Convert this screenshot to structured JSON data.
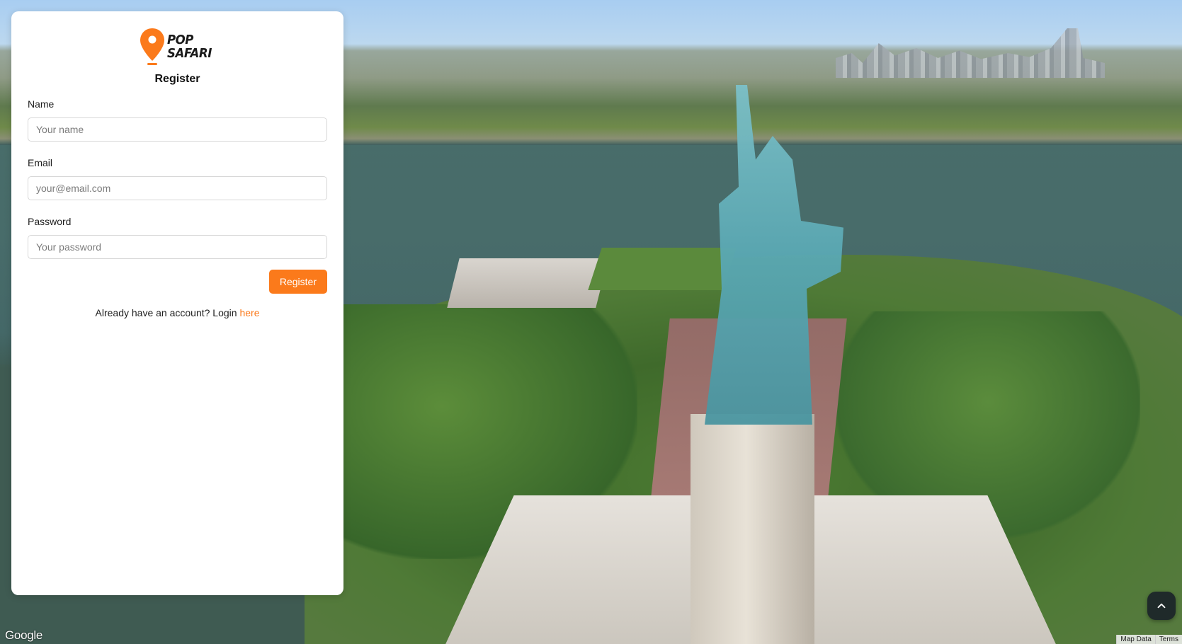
{
  "app": {
    "brand_line1": "POP",
    "brand_line2": "SAFARI",
    "accent_color": "#fb7a1b"
  },
  "form": {
    "title": "Register",
    "fields": [
      {
        "label": "Name",
        "placeholder": "Your name",
        "value": ""
      },
      {
        "label": "Email",
        "placeholder": "your@email.com",
        "value": ""
      },
      {
        "label": "Password",
        "placeholder": "Your password",
        "value": ""
      }
    ],
    "submit_label": "Register",
    "login_prompt": "Already have an account? Login",
    "login_link": "here"
  },
  "map": {
    "attribution_logo": "Google",
    "footer_links": [
      "Map Data",
      "Terms"
    ],
    "scroll_top_icon": "chevron-up-icon"
  }
}
